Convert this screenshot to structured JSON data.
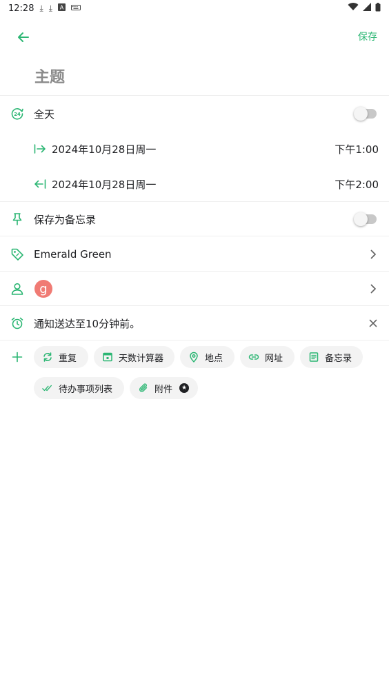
{
  "status": {
    "time": "12:28"
  },
  "app_bar": {
    "save_label": "保存"
  },
  "subject": {
    "placeholder": "主题"
  },
  "all_day": {
    "label": "全天",
    "enabled": false
  },
  "start": {
    "date": "2024年10月28日周一",
    "time": "下午1:00"
  },
  "end": {
    "date": "2024年10月28日周一",
    "time": "下午2:00"
  },
  "save_as_memo": {
    "label": "保存为备忘录",
    "enabled": false
  },
  "color": {
    "label": "Emerald Green"
  },
  "attendee": {
    "initial": "g"
  },
  "notification": {
    "label": "通知送达至10分钟前。"
  },
  "chips": {
    "repeat": "重复",
    "day_calc": "天数计算器",
    "location": "地点",
    "url": "网址",
    "memo": "备忘录",
    "todo": "待办事项列表",
    "attachment": "附件"
  },
  "colors": {
    "accent": "#2bb673",
    "avatar": "#f07b74"
  }
}
